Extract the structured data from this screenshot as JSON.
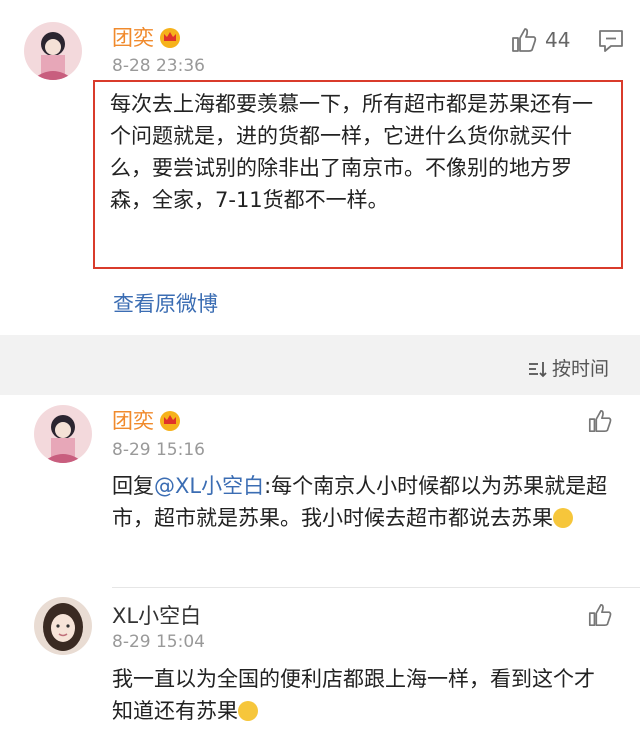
{
  "post": {
    "username": "团奕",
    "timestamp": "8-28 23:36",
    "like_count": "44",
    "text": "每次去上海都要羡慕一下，所有超市都是苏果还有一个问题就是，进的货都一样，它进什么货你就买什么，要尝试别的除非出了南京市。不像别的地方罗森，全家，7-11货都不一样。",
    "view_original": "查看原微博",
    "highlight_color": "#d93b2b"
  },
  "sort": {
    "label": "按时间"
  },
  "comments": [
    {
      "username": "团奕",
      "timestamp": "8-29 15:16",
      "reply_prefix": "回复",
      "mention": "@XL小空白",
      "text": ":每个南京人小时候都以为苏果就是超市，超市就是苏果。我小时候去超市都说去苏果",
      "emoji": "laughing-tears"
    },
    {
      "username": "XL小空白",
      "timestamp": "8-29 15:04",
      "text": "我一直以为全国的便利店都跟上海一样，看到这个才知道还有苏果",
      "emoji": "laughing-tears"
    }
  ],
  "colors": {
    "username": "#f08a2c",
    "link": "#3b6db3",
    "muted": "#999999"
  },
  "icons": [
    "crown-badge-icon",
    "thumbs-up-icon",
    "comment-icon",
    "sort-icon"
  ]
}
